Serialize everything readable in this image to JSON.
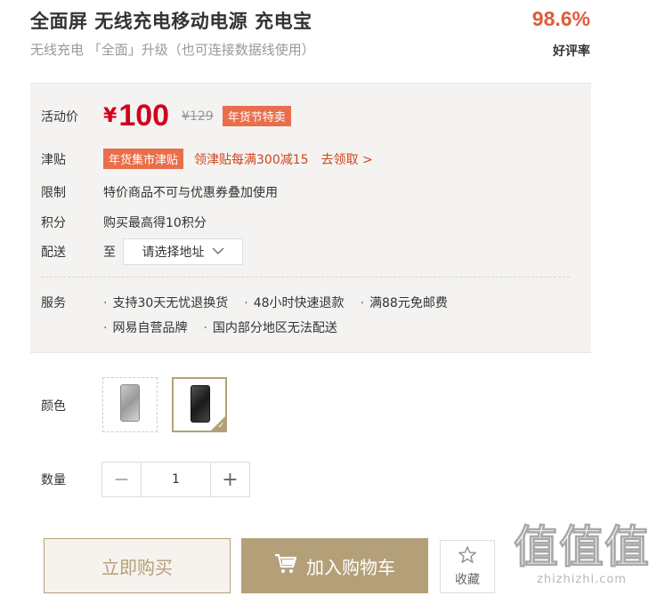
{
  "header": {
    "title": "全面屏 无线充电移动电源 充电宝",
    "subtitle": "无线充电 「全面」升级（也可连接数据线使用）",
    "rating": "98.6%",
    "rating_label": "好评率"
  },
  "promo": {
    "price_label": "活动价",
    "currency": "¥",
    "price": "100",
    "original_price": "¥129",
    "price_tag": "年货节特卖",
    "subsidy_label": "津贴",
    "subsidy_tag": "年货集市津贴",
    "subsidy_text": "领津贴每满300减15",
    "subsidy_link": "去领取 >",
    "limit_label": "限制",
    "limit_text": "特价商品不可与优惠券叠加使用",
    "points_label": "积分",
    "points_text": "购买最高得10积分",
    "delivery_label": "配送",
    "delivery_to": "至",
    "address_placeholder": "请选择地址",
    "service_label": "服务",
    "services": [
      "支持30天无忧退换货",
      "48小时快速退款",
      "满88元免邮费",
      "网易自营品牌",
      "国内部分地区无法配送"
    ]
  },
  "options": {
    "color_label": "颜色",
    "colors": [
      "silver",
      "black"
    ],
    "selected_color": "black",
    "quantity_label": "数量",
    "quantity": "1",
    "minus": "−",
    "plus": "+"
  },
  "actions": {
    "buy_now": "立即购买",
    "add_to_cart": "加入购物车",
    "favorite": "收藏"
  },
  "watermark": {
    "big": "值值值",
    "small": "zhizhizhi.com"
  },
  "colors": {
    "accent": "#b4a078",
    "price_red": "#d0021b",
    "tag_orange": "#e96e4c"
  }
}
